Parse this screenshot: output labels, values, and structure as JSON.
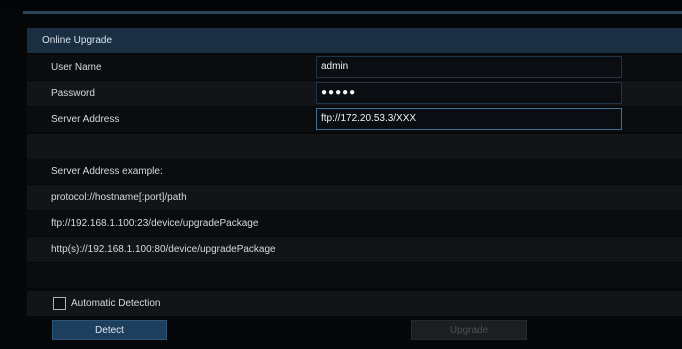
{
  "section": {
    "title": "Online Upgrade"
  },
  "form": {
    "user_name_label": "User Name",
    "user_name_value": "admin",
    "password_label": "Password",
    "password_value": "●●●●●",
    "server_address_label": "Server Address",
    "server_address_value": "ftp://172.20.53.3/XXX"
  },
  "help": {
    "heading": "Server Address example:",
    "format": "protocol://hostname[:port]/path",
    "example_ftp": "ftp://192.168.1.100:23/device/upgradePackage",
    "example_http": "http(s)://192.168.1.100:80/device/upgradePackage"
  },
  "auto_detection": {
    "label": "Automatic Detection",
    "checked": false
  },
  "buttons": {
    "detect": "Detect",
    "upgrade": "Upgrade"
  },
  "colors": {
    "accent": "#1d3e5c",
    "header": "#1a2f42",
    "field_border": "#203446"
  }
}
